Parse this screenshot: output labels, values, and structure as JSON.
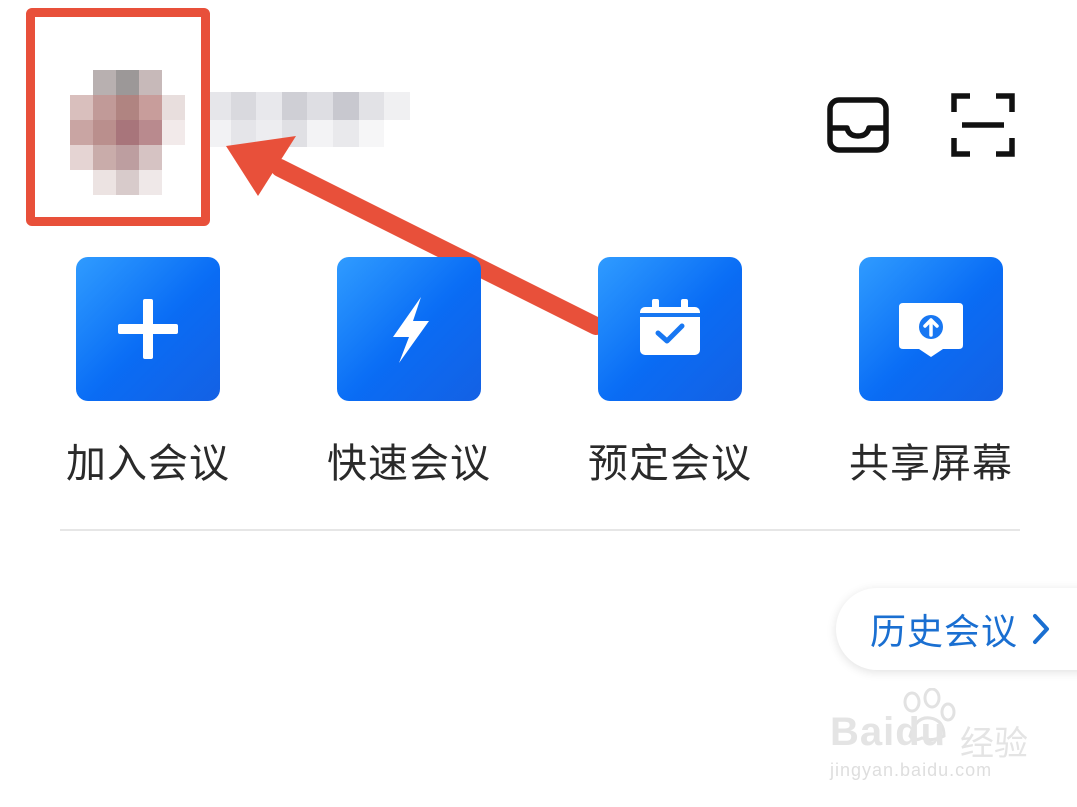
{
  "header": {
    "inbox_icon": "inbox-icon",
    "scan_icon": "scan-icon"
  },
  "actions": [
    {
      "label": "加入会议",
      "icon": "plus-icon"
    },
    {
      "label": "快速会议",
      "icon": "lightning-icon"
    },
    {
      "label": "预定会议",
      "icon": "calendar-check-icon"
    },
    {
      "label": "共享屏幕",
      "icon": "share-screen-icon"
    }
  ],
  "history": {
    "label": "历史会议",
    "icon": "chevron-right-icon"
  },
  "colors": {
    "tile_blue": "#0a6cf5",
    "link_blue": "#1a6fd1",
    "annotation_red": "#e8503a"
  },
  "watermark": {
    "brand": "Baidu",
    "jingyan": "经验",
    "url": "jingyan.baidu.com"
  }
}
